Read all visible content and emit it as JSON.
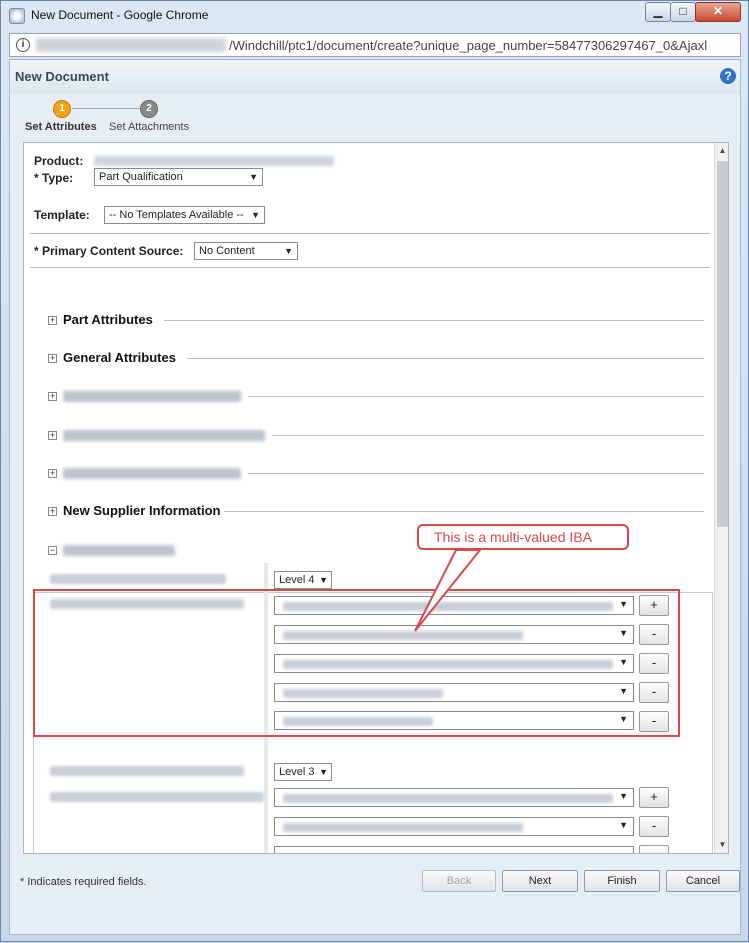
{
  "window": {
    "title": "New Document - Google Chrome",
    "controls": {
      "minimize": "▁",
      "maximize": "□",
      "close": "✕"
    }
  },
  "address_bar": {
    "url_visible": "/Windchill/ptc1/document/create?unique_page_number=58477306297467_0&Ajaxl"
  },
  "page": {
    "title": "New Document",
    "help_icon": "?"
  },
  "wizard": {
    "steps": [
      {
        "number": "1",
        "label": "Set Attributes",
        "state": "active"
      },
      {
        "number": "2",
        "label": "Set Attachments",
        "state": "inactive"
      }
    ]
  },
  "form": {
    "product_label": "Product:",
    "type_label": "* Type:",
    "type_value": "Part Qualification",
    "template_label": "Template:",
    "template_value": "-- No Templates Available --",
    "primary_content_label": "* Primary Content Source:",
    "primary_content_value": "No Content",
    "sections": [
      {
        "title": "Part Attributes",
        "expander": "+"
      },
      {
        "title": "General Attributes",
        "expander": "+"
      },
      {
        "title": "",
        "expander": "+"
      },
      {
        "title": "",
        "expander": "+"
      },
      {
        "title": "",
        "expander": "+"
      },
      {
        "title": "New Supplier Information",
        "expander": "+"
      },
      {
        "title": "",
        "expander": "−"
      }
    ],
    "ppap": {
      "sample_level_value": "Level 4",
      "sample_add_button": "+",
      "sample_remove_button": "-",
      "production_level_value": "Level 3",
      "production_add_button": "+",
      "production_remove_button": "-"
    }
  },
  "annotation": {
    "callout_text": "This is a multi-valued IBA",
    "color": "#d84a4a"
  },
  "footer": {
    "required_note": "* Indicates required fields.",
    "buttons": {
      "back": "Back",
      "next": "Next",
      "finish": "Finish",
      "cancel": "Cancel"
    }
  },
  "icons": {
    "app": "chrome-app-icon",
    "info": "info-icon",
    "help": "help-icon",
    "dropdown": "chevron-down-icon"
  }
}
